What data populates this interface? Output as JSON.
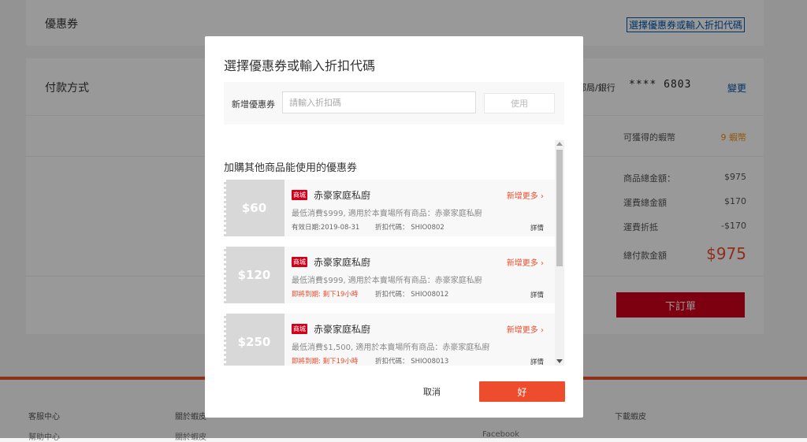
{
  "page": {
    "coupon_label": "優惠券",
    "select_coupon_link": "選擇優惠券或輸入折扣代碼",
    "payment_label": "付款方式",
    "bank_label": "郵局/銀行",
    "card_number": "**** 6803",
    "change_link": "變更",
    "coins_label": "可獲得的蝦幣",
    "coins_value": "9 蝦幣",
    "subtotal_label": "商品總金額：",
    "subtotal_value": "$975",
    "shipping_label": "運費總金額",
    "shipping_value": "$170",
    "shipping_discount_label": "運費折抵",
    "shipping_discount_value": "-$170",
    "total_label": "總付款金額",
    "total_value": "$975",
    "place_order": "下訂單"
  },
  "footer": {
    "cols": [
      {
        "title": "客服中心",
        "link": "幫助中心"
      },
      {
        "title": "關於蝦皮",
        "link": "關於蝦皮"
      },
      {
        "title": "",
        "link": ""
      },
      {
        "title": "",
        "link": "Facebook"
      },
      {
        "title": "下載蝦皮",
        "link": ""
      }
    ]
  },
  "modal": {
    "title": "選擇優惠券或輸入折扣代碼",
    "add_label": "新增優惠券",
    "code_placeholder": "請輸入折扣碼",
    "use_button": "使用",
    "section_title": "加購其他商品能使用的優惠券",
    "coupons": [
      {
        "amount": "$60",
        "tag": "商城",
        "shop": "赤豪家庭私廚",
        "more": "新增更多",
        "desc": "最低消費$999, 適用於本賣場所有商品：赤豪家庭私廚",
        "expiry": "有效日期:2019-08-31",
        "code": "折扣代碼： SHIO0802",
        "detail": "詳情"
      },
      {
        "amount": "$120",
        "tag": "商城",
        "shop": "赤豪家庭私廚",
        "more": "新增更多",
        "desc": "最低消費$999, 適用於本賣場所有商品：赤豪家庭私廚",
        "expiry": "即將到期: 剩下19小時",
        "code": "折扣代碼： SHIO08012",
        "detail": "詳情"
      },
      {
        "amount": "$250",
        "tag": "商城",
        "shop": "赤豪家庭私廚",
        "more": "新增更多",
        "desc": "最低消費$1,500, 適用於本賣場所有商品：赤豪家庭私廚",
        "expiry": "即將到期: 剩下19小時",
        "code": "折扣代碼： SHIO08013",
        "detail": "詳情"
      }
    ],
    "cancel_button": "取消",
    "ok_button": "好"
  },
  "colors": {
    "accent": "#ee4d2d",
    "order_button": "#d0011b",
    "link": "#0055aa",
    "coins": "#f69113"
  },
  "icons": {
    "more": "chevron-right-icon",
    "scroll_up": "arrow-up-icon",
    "scroll_down": "arrow-down-icon"
  }
}
